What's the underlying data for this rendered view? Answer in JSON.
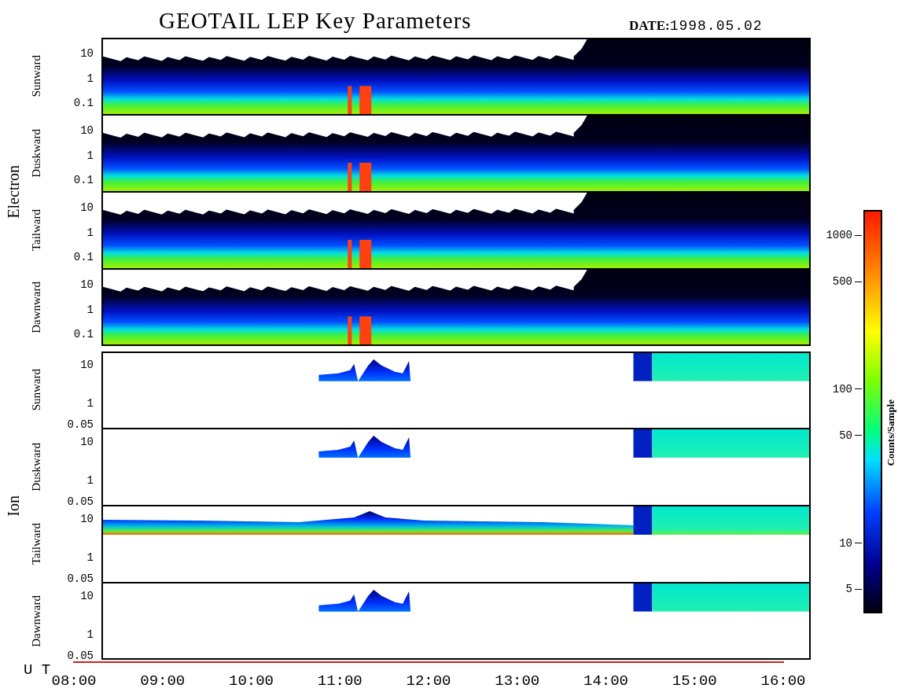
{
  "title": "GEOTAIL LEP Key Parameters",
  "date": {
    "label": "DATE:",
    "value": "1998.05.02"
  },
  "groups": [
    {
      "label": "Electron",
      "panels": [
        {
          "direction": "Sunward",
          "kind": "electron",
          "yticks": [
            "10",
            "1",
            "0.1"
          ]
        },
        {
          "direction": "Duskward",
          "kind": "electron",
          "yticks": [
            "10",
            "1",
            "0.1"
          ]
        },
        {
          "direction": "Tailward",
          "kind": "electron",
          "yticks": [
            "10",
            "1",
            "0.1"
          ]
        },
        {
          "direction": "Dawnward",
          "kind": "electron",
          "yticks": [
            "10",
            "1",
            "0.1"
          ]
        }
      ]
    },
    {
      "label": "Ion",
      "panels": [
        {
          "direction": "Sunward",
          "kind": "ion-burst",
          "yticks": [
            "10",
            "1",
            "0.05"
          ]
        },
        {
          "direction": "Duskward",
          "kind": "ion-burst",
          "yticks": [
            "10",
            "1",
            "0.05"
          ]
        },
        {
          "direction": "Tailward",
          "kind": "ion-continuous",
          "yticks": [
            "10",
            "1",
            "0.05"
          ]
        },
        {
          "direction": "Dawnward",
          "kind": "ion-burst",
          "yticks": [
            "10",
            "1",
            "0.05"
          ]
        }
      ]
    }
  ],
  "colorbar": {
    "label": "Counts/Sample",
    "ticks": [
      "1000",
      "500",
      "100",
      "50",
      "10",
      "5"
    ]
  },
  "time_axis": {
    "label": "U T",
    "ticks": [
      "08:00",
      "09:00",
      "10:00",
      "11:00",
      "12:00",
      "13:00",
      "14:00",
      "15:00",
      "16:00"
    ]
  }
}
